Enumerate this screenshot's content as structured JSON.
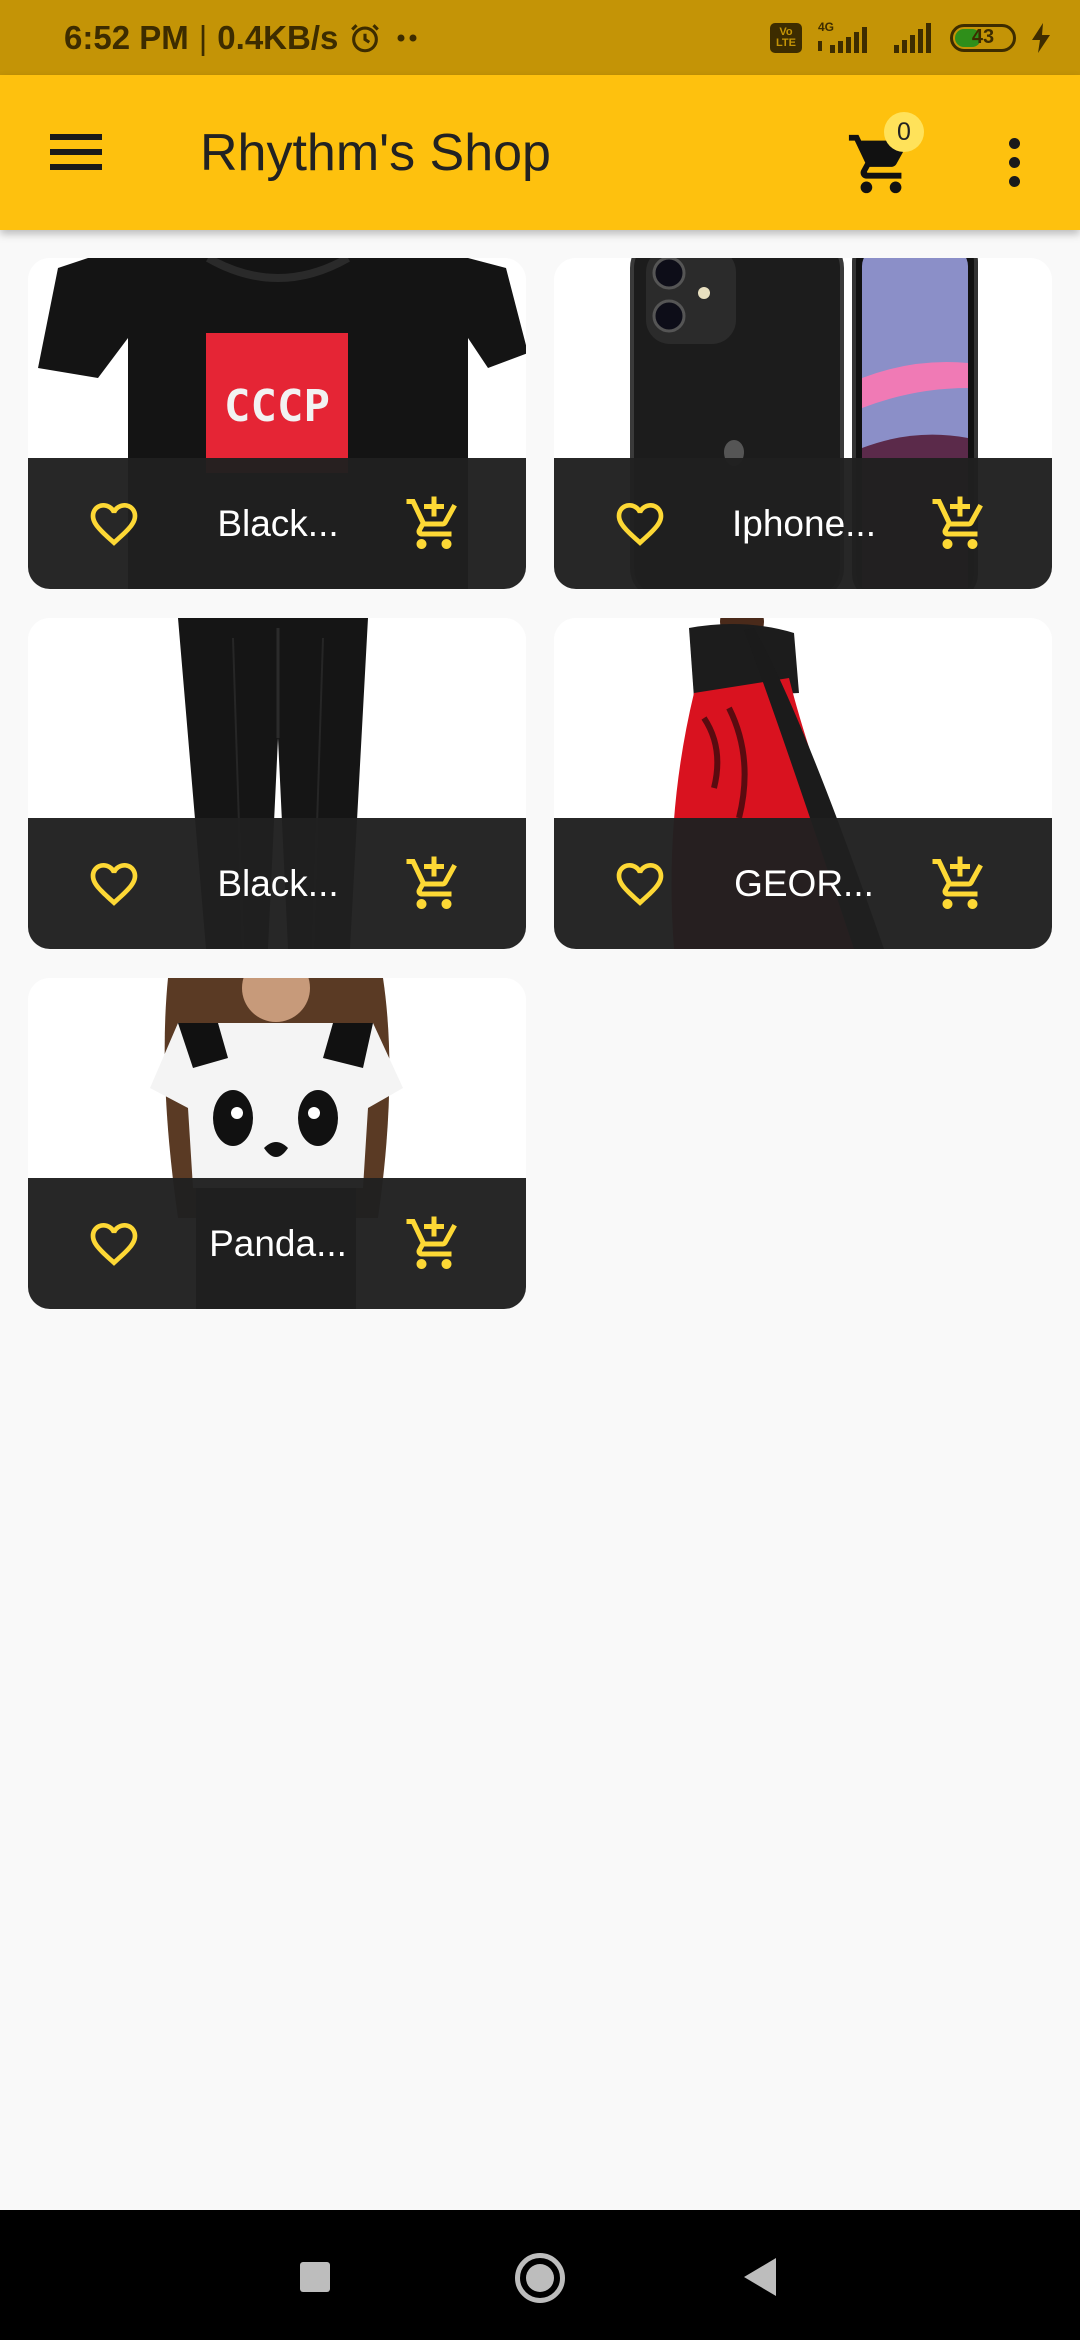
{
  "status_bar": {
    "time": "6:52 PM",
    "speed": "0.4KB/s",
    "network": "4G",
    "volte": "Vo LTE",
    "battery": "43"
  },
  "app_bar": {
    "title": "Rhythm's Shop",
    "cart_count": "0"
  },
  "products": [
    {
      "name": "Black..."
    },
    {
      "name": "Iphone..."
    },
    {
      "name": "Black..."
    },
    {
      "name": "GEOR..."
    },
    {
      "name": "Panda..."
    }
  ],
  "colors": {
    "status_bar": "#c49406",
    "app_bar": "#fec10e",
    "accent_icon": "#fdd835",
    "card_footer": "#202020"
  },
  "icons": {
    "menu": "menu-icon",
    "cart": "shopping-cart-icon",
    "more": "more-vert-icon",
    "favorite": "heart-outline-icon",
    "add_to_cart": "add-shopping-cart-icon"
  }
}
